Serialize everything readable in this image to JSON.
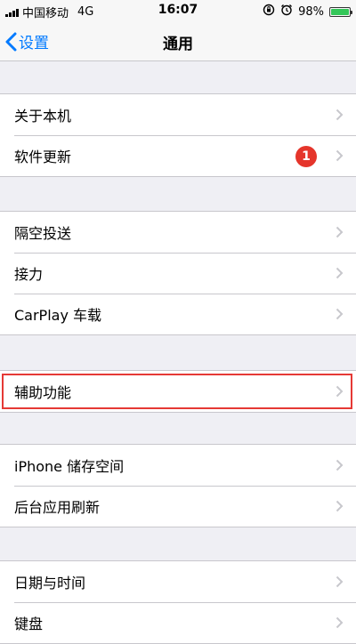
{
  "status_bar": {
    "carrier": "中国移动",
    "network": "4G",
    "time": "16:07",
    "battery_percent": "98%",
    "battery_level": 0.98,
    "icons": [
      "orientation-lock-icon",
      "alarm-icon",
      "battery-icon"
    ]
  },
  "nav": {
    "back_label": "设置",
    "title": "通用"
  },
  "groups": [
    {
      "items": [
        {
          "label": "关于本机"
        },
        {
          "label": "软件更新",
          "badge": "1"
        }
      ]
    },
    {
      "items": [
        {
          "label": "隔空投送"
        },
        {
          "label": "接力"
        },
        {
          "label": "CarPlay 车载"
        }
      ]
    },
    {
      "items": [
        {
          "label": "辅助功能",
          "highlighted": true
        }
      ]
    },
    {
      "items": [
        {
          "label": "iPhone 储存空间"
        },
        {
          "label": "后台应用刷新"
        }
      ]
    },
    {
      "items": [
        {
          "label": "日期与时间"
        },
        {
          "label": "键盘"
        }
      ]
    }
  ],
  "colors": {
    "accent": "#007aff",
    "badge": "#e5352b",
    "highlight": "#e53935",
    "background": "#efeff4",
    "battery": "#34c759"
  }
}
